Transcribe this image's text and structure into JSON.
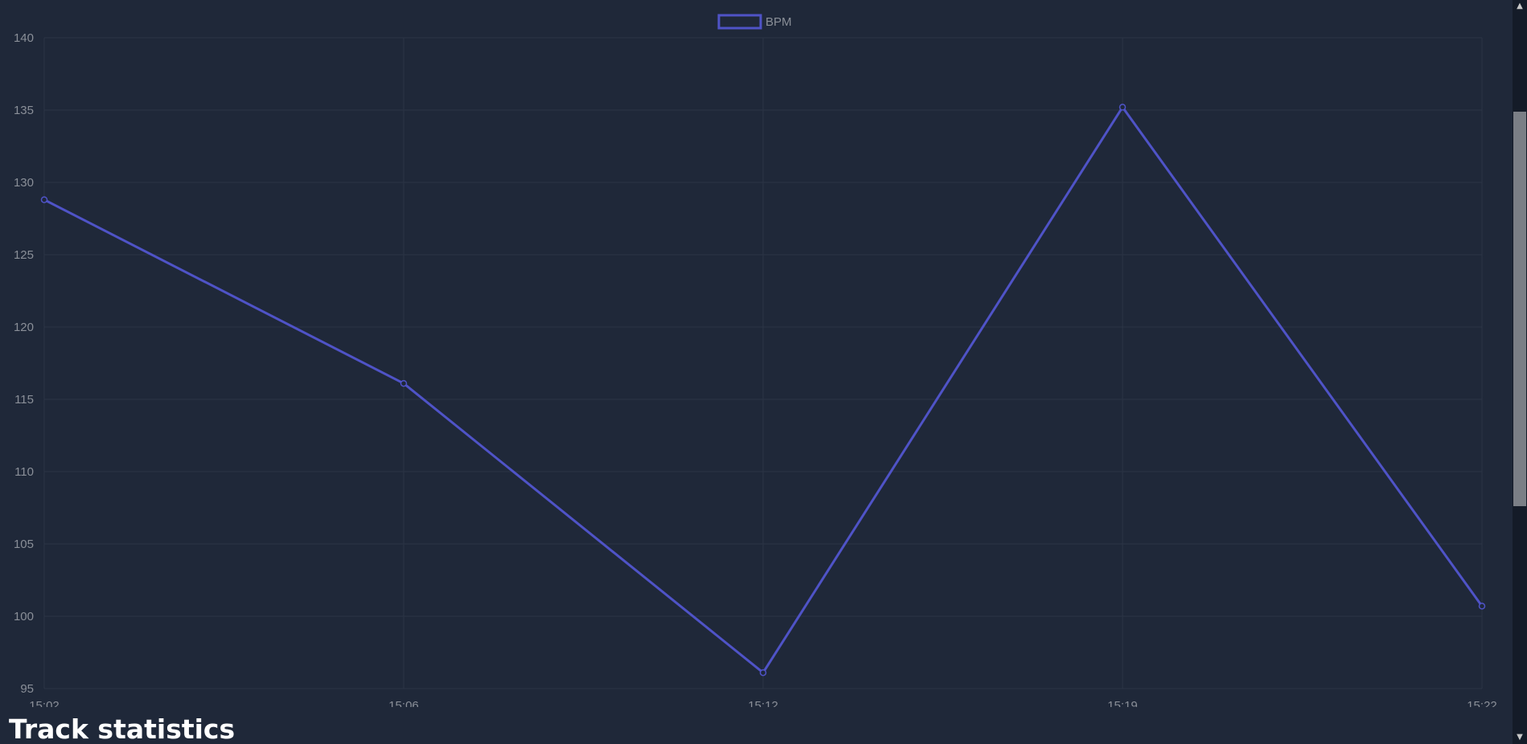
{
  "chart_data": {
    "type": "line",
    "x": [
      "15:02",
      "15:06",
      "15:12",
      "15:19",
      "15:22"
    ],
    "series": [
      {
        "name": "BPM",
        "values": [
          128.8,
          116.1,
          96.1,
          135.2,
          100.7
        ],
        "color": "#4f53c7"
      }
    ],
    "ylim": [
      95,
      140
    ],
    "yticks": [
      140,
      135,
      130,
      125,
      120,
      115,
      110,
      105,
      100,
      95
    ],
    "grid": true,
    "legend": "top-center"
  },
  "section": {
    "heading": "Track statistics"
  },
  "colors": {
    "background": "#1f2839",
    "grid": "#2b3445",
    "tick_text": "#8a8f98",
    "line": "#4f53c7"
  },
  "scrollbar": {
    "up_icon": "chevron-up-icon",
    "down_icon": "chevron-down-icon"
  }
}
